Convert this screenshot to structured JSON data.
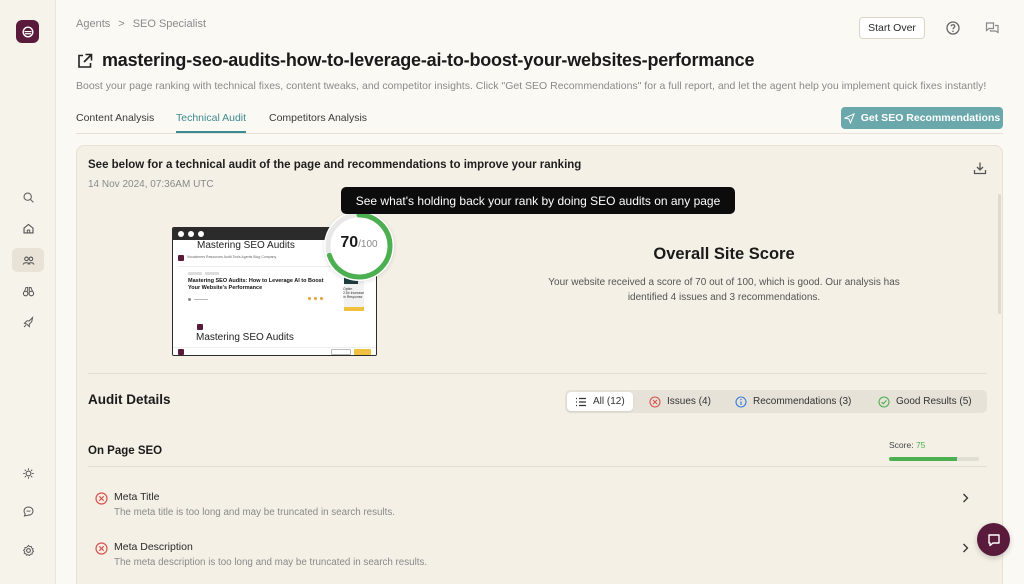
{
  "breadcrumb": {
    "root": "Agents",
    "separator": ">",
    "current": "SEO Specialist"
  },
  "header": {
    "start_over": "Start Over",
    "help_icon": "help-circle-icon",
    "chat_icon": "chat-bubbles-icon"
  },
  "page": {
    "title": "mastering-seo-audits-how-to-leverage-ai-to-boost-your-websites-performance",
    "subtitle": "Boost your page ranking with technical fixes, content tweaks, and competitor insights. Click \"Get SEO Recommendations\" for a full report, and let the agent help you implement quick fixes instantly!"
  },
  "tabs": [
    {
      "label": "Content Analysis",
      "active": false
    },
    {
      "label": "Technical Audit",
      "active": true
    },
    {
      "label": "Competitors Analysis",
      "active": false
    }
  ],
  "seo_button": "Get SEO Recommendations",
  "panel": {
    "heading": "See below for a technical audit of the page and recommendations to improve your ranking",
    "date": "14 Nov 2024, 07:36AM UTC",
    "tooltip": "See what's holding back your rank by doing SEO audits on any page"
  },
  "thumbnail": {
    "title": "Mastering SEO Audits",
    "nav": "Vocalzmers   Resources   Audit Tools   Agents   Blog   Company",
    "headline": "Mastering SEO Audits: How to Leverage AI to Boost Your Website's Performance",
    "card_text": "Optim\n2.5x Increase\nin Response",
    "bottom_title": "Mastering SEO Audits"
  },
  "score": {
    "value": "70",
    "max": "/100",
    "fraction": 0.7,
    "color": "#4caf50"
  },
  "overall": {
    "title": "Overall Site Score",
    "text": "Your website received a score of 70 out of 100, which is good. Our analysis has identified 4 issues and 3 recommendations."
  },
  "audit": {
    "title": "Audit Details",
    "filters": [
      {
        "label": "All (12)",
        "icon": "list-icon",
        "active": true
      },
      {
        "label": "Issues (4)",
        "icon": "x-circle-icon",
        "active": false
      },
      {
        "label": "Recommendations (3)",
        "icon": "info-circle-icon",
        "active": false
      },
      {
        "label": "Good Results (5)",
        "icon": "check-circle-icon",
        "active": false
      }
    ],
    "section": {
      "title": "On Page SEO",
      "score_label": "Score:",
      "score_value": "75",
      "score_fraction": 0.75
    },
    "items": [
      {
        "title": "Meta Title",
        "desc": "The meta title is too long and may be truncated in search results.",
        "status": "issue"
      },
      {
        "title": "Meta Description",
        "desc": "The meta description is too long and may be truncated in search results.",
        "status": "issue"
      }
    ]
  },
  "colors": {
    "accent": "#3c8b92",
    "brand": "#5a1a3c",
    "issue": "#d9534f",
    "good": "#4caf50",
    "info": "#3b7dd8"
  }
}
